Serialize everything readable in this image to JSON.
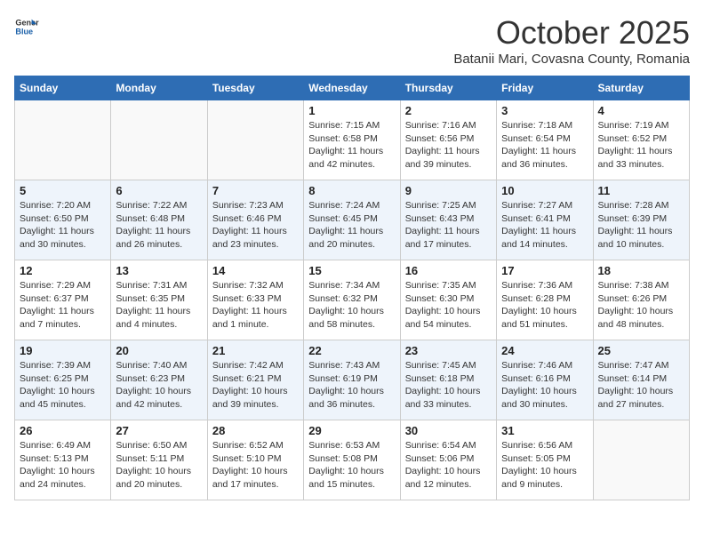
{
  "header": {
    "logo_general": "General",
    "logo_blue": "Blue",
    "month": "October 2025",
    "location": "Batanii Mari, Covasna County, Romania"
  },
  "weekdays": [
    "Sunday",
    "Monday",
    "Tuesday",
    "Wednesday",
    "Thursday",
    "Friday",
    "Saturday"
  ],
  "weeks": [
    [
      {
        "day": "",
        "info": ""
      },
      {
        "day": "",
        "info": ""
      },
      {
        "day": "",
        "info": ""
      },
      {
        "day": "1",
        "info": "Sunrise: 7:15 AM\nSunset: 6:58 PM\nDaylight: 11 hours and 42 minutes."
      },
      {
        "day": "2",
        "info": "Sunrise: 7:16 AM\nSunset: 6:56 PM\nDaylight: 11 hours and 39 minutes."
      },
      {
        "day": "3",
        "info": "Sunrise: 7:18 AM\nSunset: 6:54 PM\nDaylight: 11 hours and 36 minutes."
      },
      {
        "day": "4",
        "info": "Sunrise: 7:19 AM\nSunset: 6:52 PM\nDaylight: 11 hours and 33 minutes."
      }
    ],
    [
      {
        "day": "5",
        "info": "Sunrise: 7:20 AM\nSunset: 6:50 PM\nDaylight: 11 hours and 30 minutes."
      },
      {
        "day": "6",
        "info": "Sunrise: 7:22 AM\nSunset: 6:48 PM\nDaylight: 11 hours and 26 minutes."
      },
      {
        "day": "7",
        "info": "Sunrise: 7:23 AM\nSunset: 6:46 PM\nDaylight: 11 hours and 23 minutes."
      },
      {
        "day": "8",
        "info": "Sunrise: 7:24 AM\nSunset: 6:45 PM\nDaylight: 11 hours and 20 minutes."
      },
      {
        "day": "9",
        "info": "Sunrise: 7:25 AM\nSunset: 6:43 PM\nDaylight: 11 hours and 17 minutes."
      },
      {
        "day": "10",
        "info": "Sunrise: 7:27 AM\nSunset: 6:41 PM\nDaylight: 11 hours and 14 minutes."
      },
      {
        "day": "11",
        "info": "Sunrise: 7:28 AM\nSunset: 6:39 PM\nDaylight: 11 hours and 10 minutes."
      }
    ],
    [
      {
        "day": "12",
        "info": "Sunrise: 7:29 AM\nSunset: 6:37 PM\nDaylight: 11 hours and 7 minutes."
      },
      {
        "day": "13",
        "info": "Sunrise: 7:31 AM\nSunset: 6:35 PM\nDaylight: 11 hours and 4 minutes."
      },
      {
        "day": "14",
        "info": "Sunrise: 7:32 AM\nSunset: 6:33 PM\nDaylight: 11 hours and 1 minute."
      },
      {
        "day": "15",
        "info": "Sunrise: 7:34 AM\nSunset: 6:32 PM\nDaylight: 10 hours and 58 minutes."
      },
      {
        "day": "16",
        "info": "Sunrise: 7:35 AM\nSunset: 6:30 PM\nDaylight: 10 hours and 54 minutes."
      },
      {
        "day": "17",
        "info": "Sunrise: 7:36 AM\nSunset: 6:28 PM\nDaylight: 10 hours and 51 minutes."
      },
      {
        "day": "18",
        "info": "Sunrise: 7:38 AM\nSunset: 6:26 PM\nDaylight: 10 hours and 48 minutes."
      }
    ],
    [
      {
        "day": "19",
        "info": "Sunrise: 7:39 AM\nSunset: 6:25 PM\nDaylight: 10 hours and 45 minutes."
      },
      {
        "day": "20",
        "info": "Sunrise: 7:40 AM\nSunset: 6:23 PM\nDaylight: 10 hours and 42 minutes."
      },
      {
        "day": "21",
        "info": "Sunrise: 7:42 AM\nSunset: 6:21 PM\nDaylight: 10 hours and 39 minutes."
      },
      {
        "day": "22",
        "info": "Sunrise: 7:43 AM\nSunset: 6:19 PM\nDaylight: 10 hours and 36 minutes."
      },
      {
        "day": "23",
        "info": "Sunrise: 7:45 AM\nSunset: 6:18 PM\nDaylight: 10 hours and 33 minutes."
      },
      {
        "day": "24",
        "info": "Sunrise: 7:46 AM\nSunset: 6:16 PM\nDaylight: 10 hours and 30 minutes."
      },
      {
        "day": "25",
        "info": "Sunrise: 7:47 AM\nSunset: 6:14 PM\nDaylight: 10 hours and 27 minutes."
      }
    ],
    [
      {
        "day": "26",
        "info": "Sunrise: 6:49 AM\nSunset: 5:13 PM\nDaylight: 10 hours and 24 minutes."
      },
      {
        "day": "27",
        "info": "Sunrise: 6:50 AM\nSunset: 5:11 PM\nDaylight: 10 hours and 20 minutes."
      },
      {
        "day": "28",
        "info": "Sunrise: 6:52 AM\nSunset: 5:10 PM\nDaylight: 10 hours and 17 minutes."
      },
      {
        "day": "29",
        "info": "Sunrise: 6:53 AM\nSunset: 5:08 PM\nDaylight: 10 hours and 15 minutes."
      },
      {
        "day": "30",
        "info": "Sunrise: 6:54 AM\nSunset: 5:06 PM\nDaylight: 10 hours and 12 minutes."
      },
      {
        "day": "31",
        "info": "Sunrise: 6:56 AM\nSunset: 5:05 PM\nDaylight: 10 hours and 9 minutes."
      },
      {
        "day": "",
        "info": ""
      }
    ]
  ]
}
